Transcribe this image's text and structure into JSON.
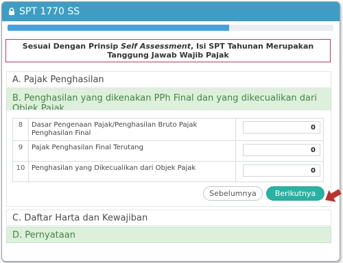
{
  "header": {
    "title": "SPT 1770 SS",
    "icon": "lock-icon"
  },
  "progress": {
    "percent": 68,
    "color": "#4aa0db"
  },
  "notice": {
    "text_before": "Sesuai Dengan Prinsip ",
    "text_emph": "Self Assessment",
    "text_after": ", Isi SPT Tahunan Merupakan Tanggung Jawab Wajib Pajak"
  },
  "sections": {
    "a": "A. Pajak Penghasilan",
    "b": "B. Penghasilan yang dikenakan PPh Final dan yang dikecualikan dari Objek Pajak",
    "c": "C. Daftar Harta dan Kewajiban",
    "d": "D. Pernyataan"
  },
  "rows": [
    {
      "no": "8",
      "label": "Dasar Pengenaan Pajak/Penghasilan Bruto Pajak Penghasilan Final",
      "value": "0"
    },
    {
      "no": "9",
      "label": "Pajak Penghasilan Final Terutang",
      "value": "0"
    },
    {
      "no": "10",
      "label": "Penghasilan yang Dikecualikan dari Objek Pajak",
      "value": "0"
    }
  ],
  "buttons": {
    "prev": "Sebelumnya",
    "next": "Berikutnya"
  },
  "colors": {
    "header": "#3f9dc4",
    "accent": "#2ab1a2",
    "notice_border": "#b23a56",
    "arrow": "#b7342f"
  }
}
